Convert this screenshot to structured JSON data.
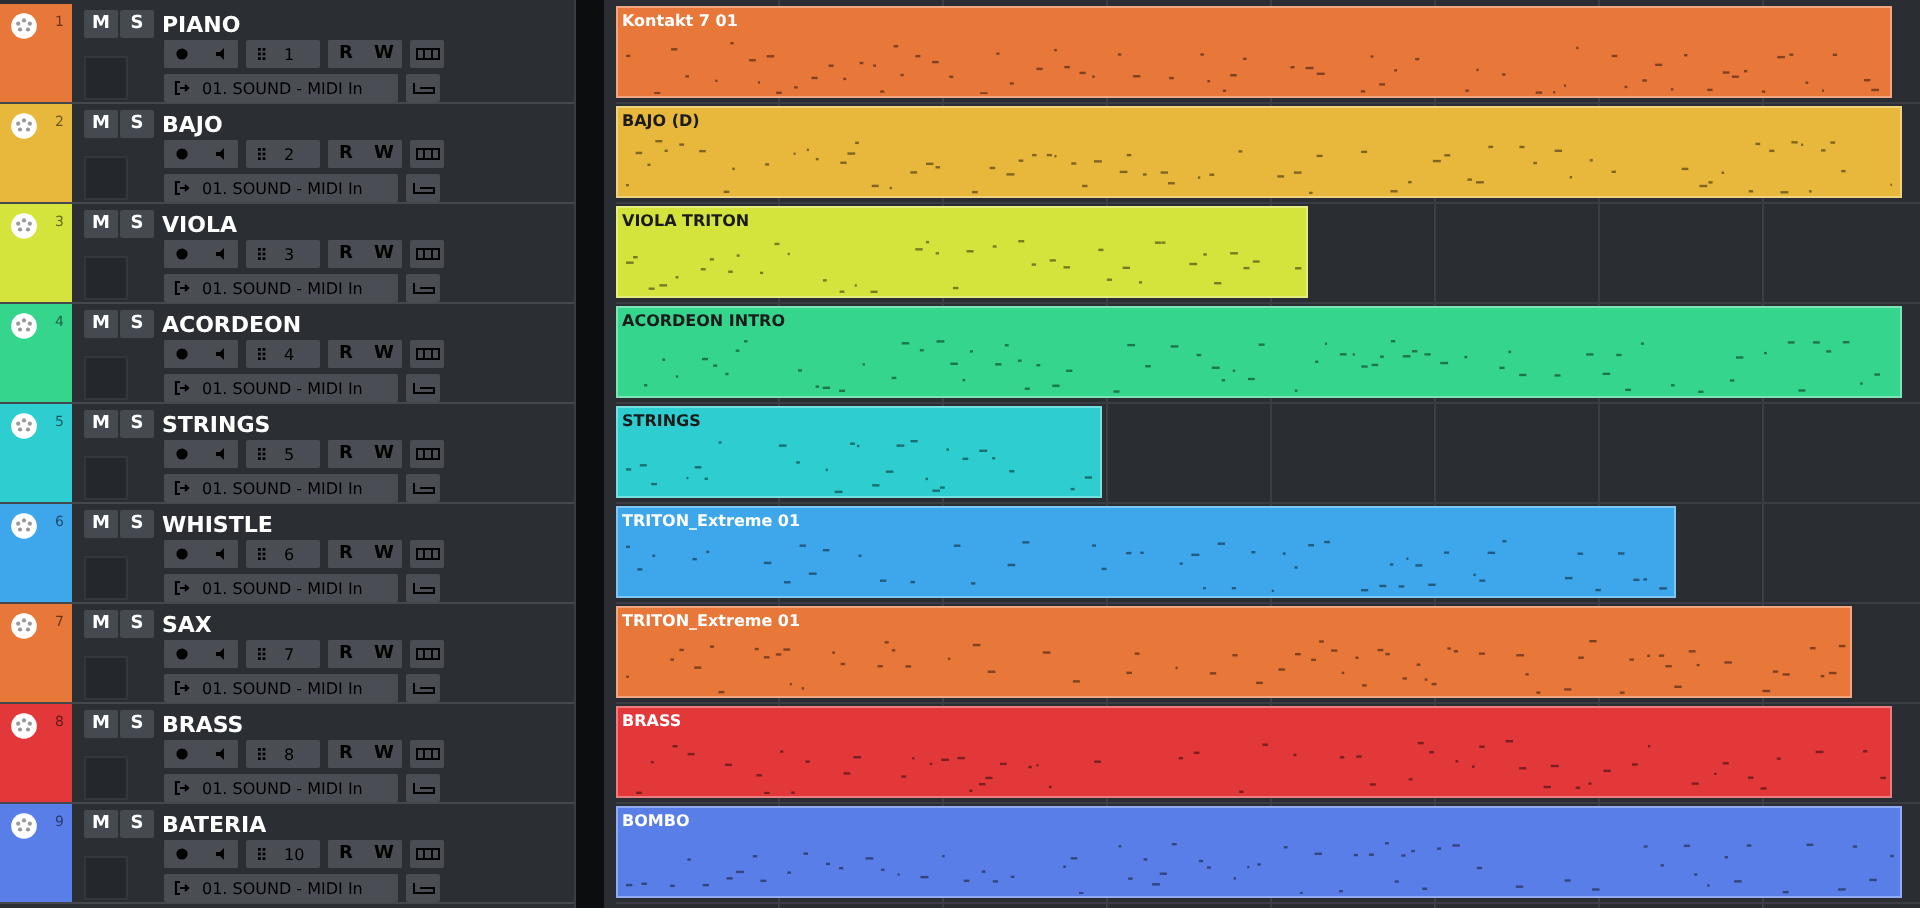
{
  "tracks": [
    {
      "number": "1",
      "name": "PIANO",
      "color": "#e8773a",
      "buttons": {
        "mute": "M",
        "solo": "S",
        "read": "R",
        "write": "W"
      },
      "channel": "1",
      "routing": "01. SOUND - MIDI In",
      "clip": {
        "title": "Kontakt 7 01",
        "level": 0.979
      }
    },
    {
      "number": "2",
      "name": "BAJO",
      "color": "#e8b83c",
      "buttons": {
        "mute": "M",
        "solo": "S",
        "read": "R",
        "write": "W"
      },
      "channel": "2",
      "routing": "01. SOUND - MIDI In",
      "clip": {
        "title": "BAJO (D)",
        "level": 0.986
      }
    },
    {
      "number": "3",
      "name": "VIOLA",
      "color": "#d4e43c",
      "buttons": {
        "mute": "M",
        "solo": "S",
        "read": "R",
        "write": "W"
      },
      "channel": "3",
      "routing": "01. SOUND - MIDI In",
      "clip": {
        "title": "VIOLA TRITON",
        "level": 0.531
      }
    },
    {
      "number": "4",
      "name": "ACORDEON",
      "color": "#36d58e",
      "buttons": {
        "mute": "M",
        "solo": "S",
        "read": "R",
        "write": "W"
      },
      "channel": "4",
      "routing": "01. SOUND - MIDI In",
      "clip": {
        "title": "ACORDEON INTRO",
        "level": 0.986
      }
    },
    {
      "number": "5",
      "name": "STRINGS",
      "color": "#2ecdd0",
      "buttons": {
        "mute": "M",
        "solo": "S",
        "read": "R",
        "write": "W"
      },
      "channel": "5",
      "routing": "01. SOUND - MIDI In",
      "clip": {
        "title": "STRINGS",
        "level": 0.373
      }
    },
    {
      "number": "6",
      "name": "WHISTLE",
      "color": "#3ea6ea",
      "buttons": {
        "mute": "M",
        "solo": "S",
        "read": "R",
        "write": "W"
      },
      "channel": "6",
      "routing": "01. SOUND - MIDI In",
      "clip": {
        "title": "TRITON_Extreme 01",
        "level": 0.813
      }
    },
    {
      "number": "7",
      "name": "SAX",
      "color": "#e8773a",
      "buttons": {
        "mute": "M",
        "solo": "S",
        "read": "R",
        "write": "W"
      },
      "channel": "7",
      "routing": "01. SOUND - MIDI In",
      "clip": {
        "title": "TRITON_Extreme 01",
        "level": 0.948
      }
    },
    {
      "number": "8",
      "name": "BRASS",
      "color": "#e2383a",
      "buttons": {
        "mute": "M",
        "solo": "S",
        "read": "R",
        "write": "W"
      },
      "channel": "8",
      "routing": "01. SOUND - MIDI In",
      "clip": {
        "title": "BRASS",
        "level": 0.979
      }
    },
    {
      "number": "9",
      "name": "BATERIA",
      "color": "#5a7ee8",
      "buttons": {
        "mute": "M",
        "solo": "S",
        "read": "R",
        "write": "W"
      },
      "channel": "10",
      "routing": "01. SOUND - MIDI In",
      "clip": {
        "title": "BOMBO",
        "level": 0.986
      }
    }
  ]
}
